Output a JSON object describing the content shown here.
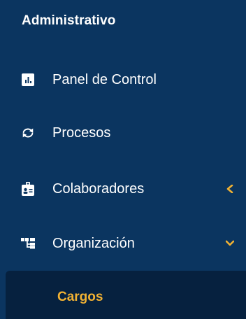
{
  "sidebar": {
    "section_title": "Administrativo",
    "items": [
      {
        "label": "Panel de Control",
        "icon": "chart-square-icon"
      },
      {
        "label": "Procesos",
        "icon": "sync-arrows-icon"
      },
      {
        "label": "Colaboradores",
        "icon": "id-badge-icon",
        "chevron": "chevron-left-icon"
      },
      {
        "label": "Organización",
        "icon": "org-chart-icon",
        "chevron": "chevron-down-icon"
      }
    ],
    "sub_items": [
      {
        "label": "Cargos",
        "active": true
      }
    ]
  },
  "colors": {
    "background": "#0b3560",
    "submenu_background": "#06213f",
    "text": "#ffffff",
    "accent": "#f2b233"
  }
}
